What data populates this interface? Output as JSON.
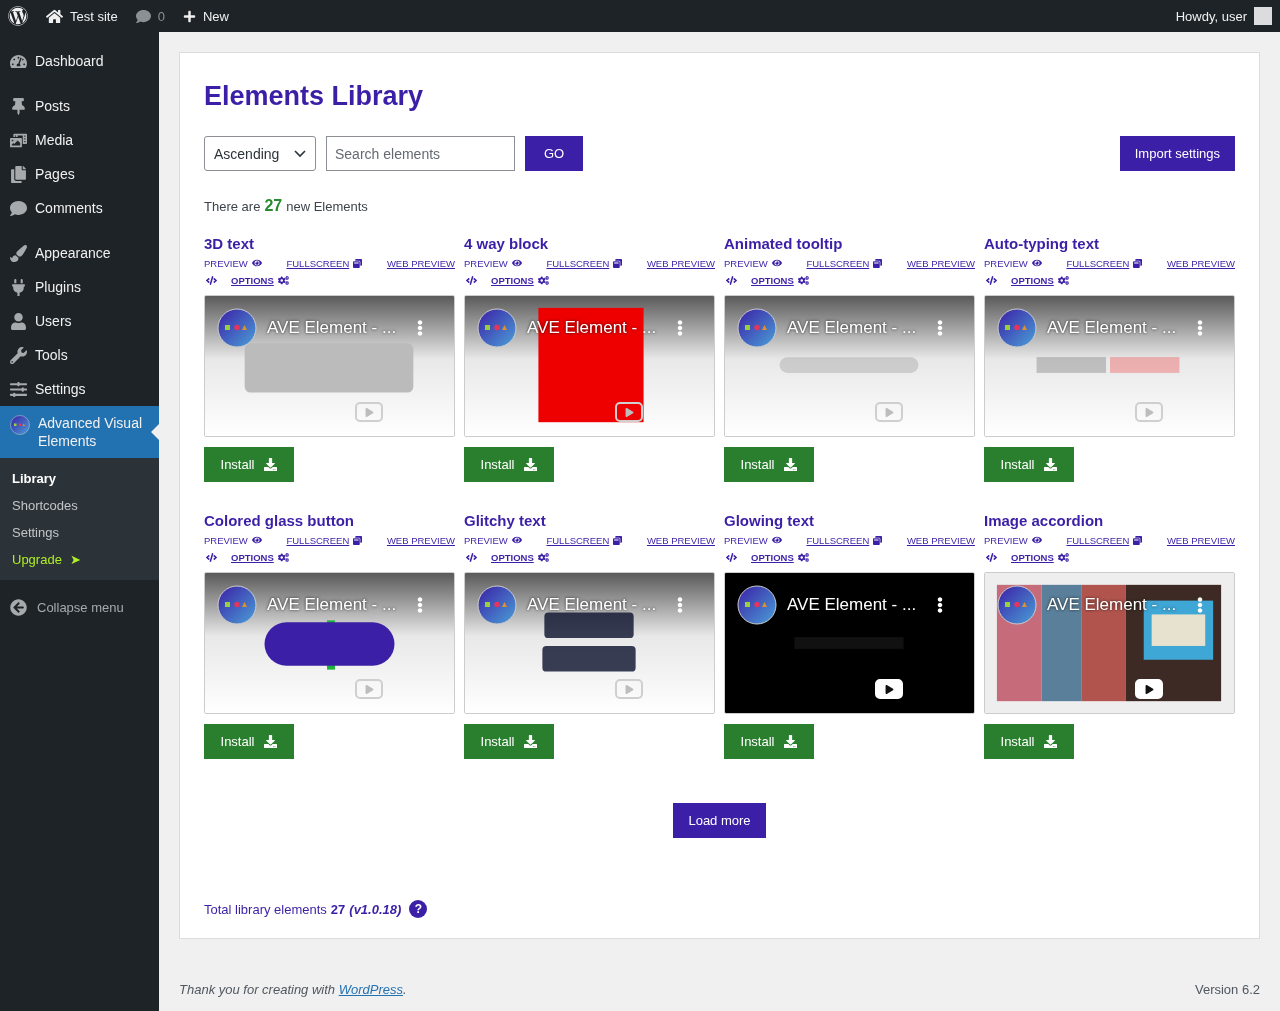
{
  "admin_bar": {
    "site": "Test site",
    "comments": "0",
    "new": "New",
    "greeting": "Howdy, user"
  },
  "menu_groups": [
    {
      "items": [
        {
          "label": "Dashboard",
          "selected": false
        }
      ]
    },
    {
      "items": [
        {
          "label": "Posts",
          "selected": false
        },
        {
          "label": "Media",
          "selected": false
        },
        {
          "label": "Pages",
          "selected": false
        },
        {
          "label": "Comments",
          "selected": false
        }
      ]
    },
    {
      "items": [
        {
          "label": "Appearance",
          "selected": false
        },
        {
          "label": "Plugins",
          "selected": false
        },
        {
          "label": "Users",
          "selected": false
        },
        {
          "label": "Tools",
          "selected": false
        },
        {
          "label": "Settings",
          "selected": false
        },
        {
          "label": "Advanced Visual Elements",
          "selected": true
        }
      ]
    }
  ],
  "submenu": [
    {
      "label": "Library",
      "selected": true,
      "kind": "link"
    },
    {
      "label": "Shortcodes",
      "selected": false,
      "kind": "link"
    },
    {
      "label": "Settings",
      "selected": false,
      "kind": "link"
    },
    {
      "label": "Upgrade",
      "selected": false,
      "kind": "upgrade",
      "arrow": "➤"
    }
  ],
  "collapse": "Collapse menu",
  "page": {
    "title": "Elements Library",
    "sort": "Ascending",
    "search_placeholder": "Search elements",
    "go": "GO",
    "import": "Import settings",
    "count_prefix": "There are",
    "count": "27",
    "count_suffix": "new Elements"
  },
  "elements": [
    {
      "title": "3D text",
      "preview": "PREVIEW",
      "fullscreen": "FULLSCREEN",
      "web_preview": "WEB PREVIEW",
      "options": "OPTIONS",
      "video_title": "AVE Element - ...",
      "install": "Install"
    },
    {
      "title": "4 way block",
      "preview": "PREVIEW",
      "fullscreen": "FULLSCREEN",
      "web_preview": "WEB PREVIEW",
      "options": "OPTIONS",
      "video_title": "AVE Element - ...",
      "install": "Install"
    },
    {
      "title": "Animated tooltip",
      "preview": "PREVIEW",
      "fullscreen": "FULLSCREEN",
      "web_preview": "WEB PREVIEW",
      "options": "OPTIONS",
      "video_title": "AVE Element - ...",
      "install": "Install"
    },
    {
      "title": "Auto-typing text",
      "preview": "PREVIEW",
      "fullscreen": "FULLSCREEN",
      "web_preview": "WEB PREVIEW",
      "options": "OPTIONS",
      "video_title": "AVE Element - ...",
      "install": "Install"
    },
    {
      "title": "Colored glass button",
      "preview": "PREVIEW",
      "fullscreen": "FULLSCREEN",
      "web_preview": "WEB PREVIEW",
      "options": "OPTIONS",
      "video_title": "AVE Element - ...",
      "install": "Install"
    },
    {
      "title": "Glitchy text",
      "preview": "PREVIEW",
      "fullscreen": "FULLSCREEN",
      "web_preview": "WEB PREVIEW",
      "options": "OPTIONS",
      "video_title": "AVE Element - ...",
      "install": "Install"
    },
    {
      "title": "Glowing text",
      "preview": "PREVIEW",
      "fullscreen": "FULLSCREEN",
      "web_preview": "WEB PREVIEW",
      "options": "OPTIONS",
      "video_title": "AVE Element - ...",
      "install": "Install"
    },
    {
      "title": "Image accordion",
      "preview": "PREVIEW",
      "fullscreen": "FULLSCREEN",
      "web_preview": "WEB PREVIEW",
      "options": "OPTIONS",
      "video_title": "AVE Element - ...",
      "install": "Install"
    }
  ],
  "load_more": "Load more",
  "total": {
    "label": "Total library elements",
    "count": "27",
    "version": "(v1.0.18)",
    "help": "?"
  },
  "footer": {
    "prefix": "Thank you for creating with",
    "link": "WordPress",
    "suffix": ".",
    "version": "Version 6.2"
  }
}
